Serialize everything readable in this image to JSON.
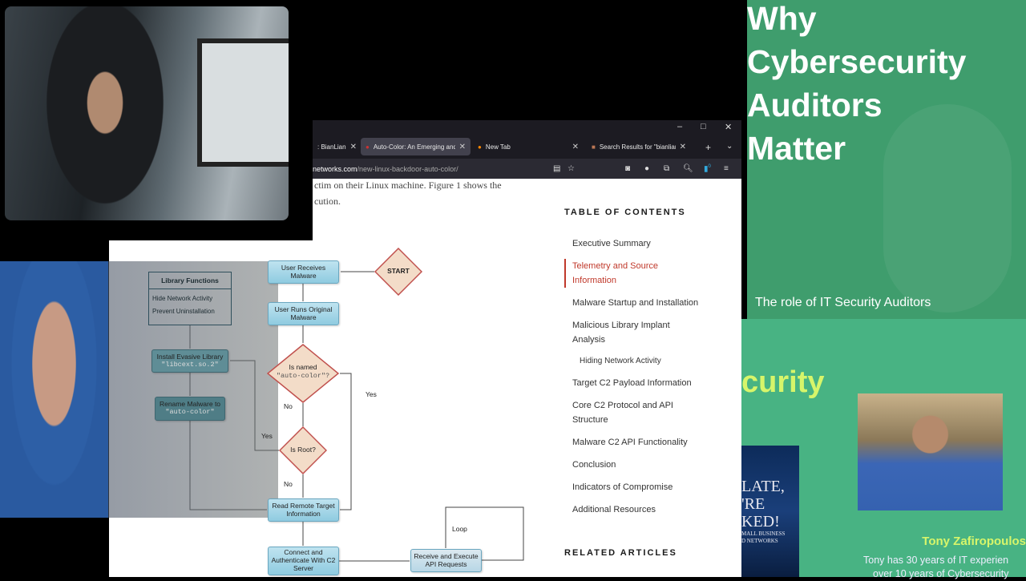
{
  "browser": {
    "tabs": [
      {
        "label": ": BianLian",
        "active": false
      },
      {
        "label": "Auto-Color: An Emerging and",
        "active": true
      },
      {
        "label": "New Tab",
        "active": false
      },
      {
        "label": "Search Results for \"bianlian\" –",
        "active": false
      }
    ],
    "url_domain": "networks.com",
    "url_path": "/new-linux-backdoor-auto-color/",
    "extension_badge": "0"
  },
  "article": {
    "text_line1": "ctim on their Linux machine. Figure 1 shows the",
    "text_line2": "cution."
  },
  "flowchart": {
    "start": "START",
    "user_receives": "User Receives Malware",
    "user_runs": "User Runs Original Malware",
    "is_named": "Is named",
    "is_named_code": "\"auto-color\"?",
    "is_root": "Is Root?",
    "read_remote": "Read Remote Target Information",
    "connect": "Connect and Authenticate With C2 Server",
    "receive": "Receive and Execute API Requests",
    "library_title": "Library Functions",
    "library_items": [
      "Hide Network Activity",
      "Prevent Uninstallation"
    ],
    "install": "Install Evasive Library",
    "install_code": "\"libcext.so.2\"",
    "rename": "Rename Malware to",
    "rename_code": "\"auto-color\"",
    "yes1": "Yes",
    "no1": "No",
    "yes2": "Yes",
    "no2": "No",
    "loop": "Loop"
  },
  "toc": {
    "heading": "TABLE OF CONTENTS",
    "items": [
      "Executive Summary",
      "Telemetry and Source Information",
      "Malware Startup and Installation",
      "Malicious Library Implant Analysis",
      "Hiding Network Activity",
      "Target C2 Payload Information",
      "Core C2 Protocol and API Structure",
      "Malware C2 API Functionality",
      "Conclusion",
      "Indicators of Compromise",
      "Additional Resources"
    ],
    "selected": "Telemetry and Source Information",
    "related_heading": "RELATED ARTICLES"
  },
  "slide": {
    "title_lines": [
      "Why",
      "Cybersecurity",
      "Auditors",
      "Matter"
    ],
    "subtitle": "The role of IT Security Auditors",
    "partial_heading": "curity",
    "book_lines": [
      "LATE,",
      "'RE",
      "KED!"
    ],
    "book_small": [
      "MALL BUSINESS",
      "D NETWORKS"
    ],
    "presenter_name": "Tony Zafiropoulos",
    "bio_line1": "Tony has 30 years of IT experien",
    "bio_line2": "over 10 years of Cybersecurity"
  },
  "colors": {
    "slide_green": "#3f9d6d",
    "slide_green_light": "#48b383",
    "accent_yellow": "#d7f56a",
    "toc_active": "#c0392b"
  }
}
